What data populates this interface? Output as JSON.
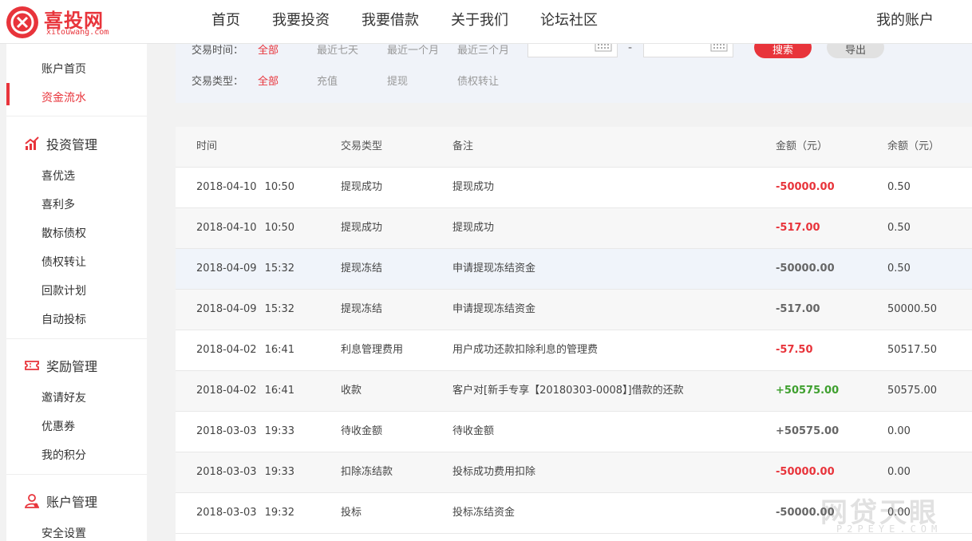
{
  "header": {
    "logo_name": "喜投网",
    "logo_domain": "xitouwang.com",
    "nav": [
      "首页",
      "我要投资",
      "我要借款",
      "关于我们",
      "论坛社区"
    ],
    "account": "我的账户"
  },
  "sidebar": {
    "top_links": [
      "账户首页",
      "资金流水"
    ],
    "active": "资金流水",
    "sections": [
      {
        "title": "投资管理",
        "icon": "chart-icon",
        "items": [
          "喜优选",
          "喜利多",
          "散标债权",
          "债权转让",
          "回款计划",
          "自动投标"
        ]
      },
      {
        "title": "奖励管理",
        "icon": "ticket-icon",
        "items": [
          "邀请好友",
          "优惠券",
          "我的积分"
        ]
      },
      {
        "title": "账户管理",
        "icon": "user-icon",
        "items": [
          "安全设置"
        ]
      }
    ]
  },
  "filter": {
    "time_label": "交易时间：",
    "time_options": [
      "全部",
      "最近七天",
      "最近一个月",
      "最近三个月"
    ],
    "time_selected": "全部",
    "date_separator": "-",
    "search_label": "搜索",
    "export_label": "导出",
    "type_label": "交易类型：",
    "type_options": [
      "全部",
      "充值",
      "提现",
      "债权转让"
    ],
    "type_selected": "全部"
  },
  "table": {
    "columns": [
      "时间",
      "交易类型",
      "备注",
      "金额（元）",
      "余额（元）"
    ],
    "rows": [
      {
        "date": "2018-04-10",
        "time": "10:50",
        "type": "提现成功",
        "note": "提现成功",
        "amount": "-50000.00",
        "amount_style": "neg",
        "balance": "0.50"
      },
      {
        "date": "2018-04-10",
        "time": "10:50",
        "type": "提现成功",
        "note": "提现成功",
        "amount": "-517.00",
        "amount_style": "neg",
        "balance": "0.50"
      },
      {
        "date": "2018-04-09",
        "time": "15:32",
        "type": "提现冻结",
        "note": "申请提现冻结资金",
        "amount": "-50000.00",
        "amount_style": "gray",
        "balance": "0.50"
      },
      {
        "date": "2018-04-09",
        "time": "15:32",
        "type": "提现冻结",
        "note": "申请提现冻结资金",
        "amount": "-517.00",
        "amount_style": "gray",
        "balance": "50000.50"
      },
      {
        "date": "2018-04-02",
        "time": "16:41",
        "type": "利息管理费用",
        "note": "用户成功还款扣除利息的管理费",
        "amount": "-57.50",
        "amount_style": "neg",
        "balance": "50517.50"
      },
      {
        "date": "2018-04-02",
        "time": "16:41",
        "type": "收款",
        "note": "客户对[新手专享【20180303-0008】]借款的还款",
        "amount": "+50575.00",
        "amount_style": "pos",
        "balance": "50575.00"
      },
      {
        "date": "2018-03-03",
        "time": "19:33",
        "type": "待收金额",
        "note": "待收金额",
        "amount": "+50575.00",
        "amount_style": "gray",
        "balance": "0.00"
      },
      {
        "date": "2018-03-03",
        "time": "19:33",
        "type": "扣除冻结款",
        "note": "投标成功费用扣除",
        "amount": "-50000.00",
        "amount_style": "neg",
        "balance": "0.00"
      },
      {
        "date": "2018-03-03",
        "time": "19:32",
        "type": "投标",
        "note": "投标冻结资金",
        "amount": "-50000.00",
        "amount_style": "gray",
        "balance": "0.00"
      }
    ]
  },
  "watermark": {
    "main": "网贷天眼",
    "sub": "P2PEYE.COM"
  },
  "colors": {
    "brand": "#e8343b",
    "positive": "#3fa02f",
    "neutral_amount": "#666666",
    "filter_bg": "#f0f3f9"
  }
}
